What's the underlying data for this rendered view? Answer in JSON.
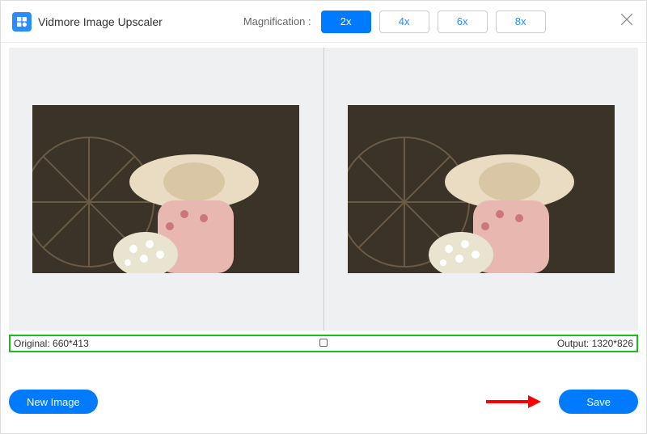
{
  "app": {
    "title": "Vidmore Image Upscaler"
  },
  "magnification": {
    "label": "Magnification :",
    "options": [
      "2x",
      "4x",
      "6x",
      "8x"
    ],
    "active": "2x"
  },
  "preview": {
    "original_label": "Original:",
    "original_size": "660*413",
    "output_label": "Output:",
    "output_size": "1320*826"
  },
  "buttons": {
    "new_image": "New Image",
    "save": "Save"
  },
  "icons": {
    "close": "close-icon",
    "logo": "app-logo"
  },
  "colors": {
    "primary": "#007aff",
    "highlight_border": "#1bbd1b",
    "arrow": "#ff0000"
  }
}
